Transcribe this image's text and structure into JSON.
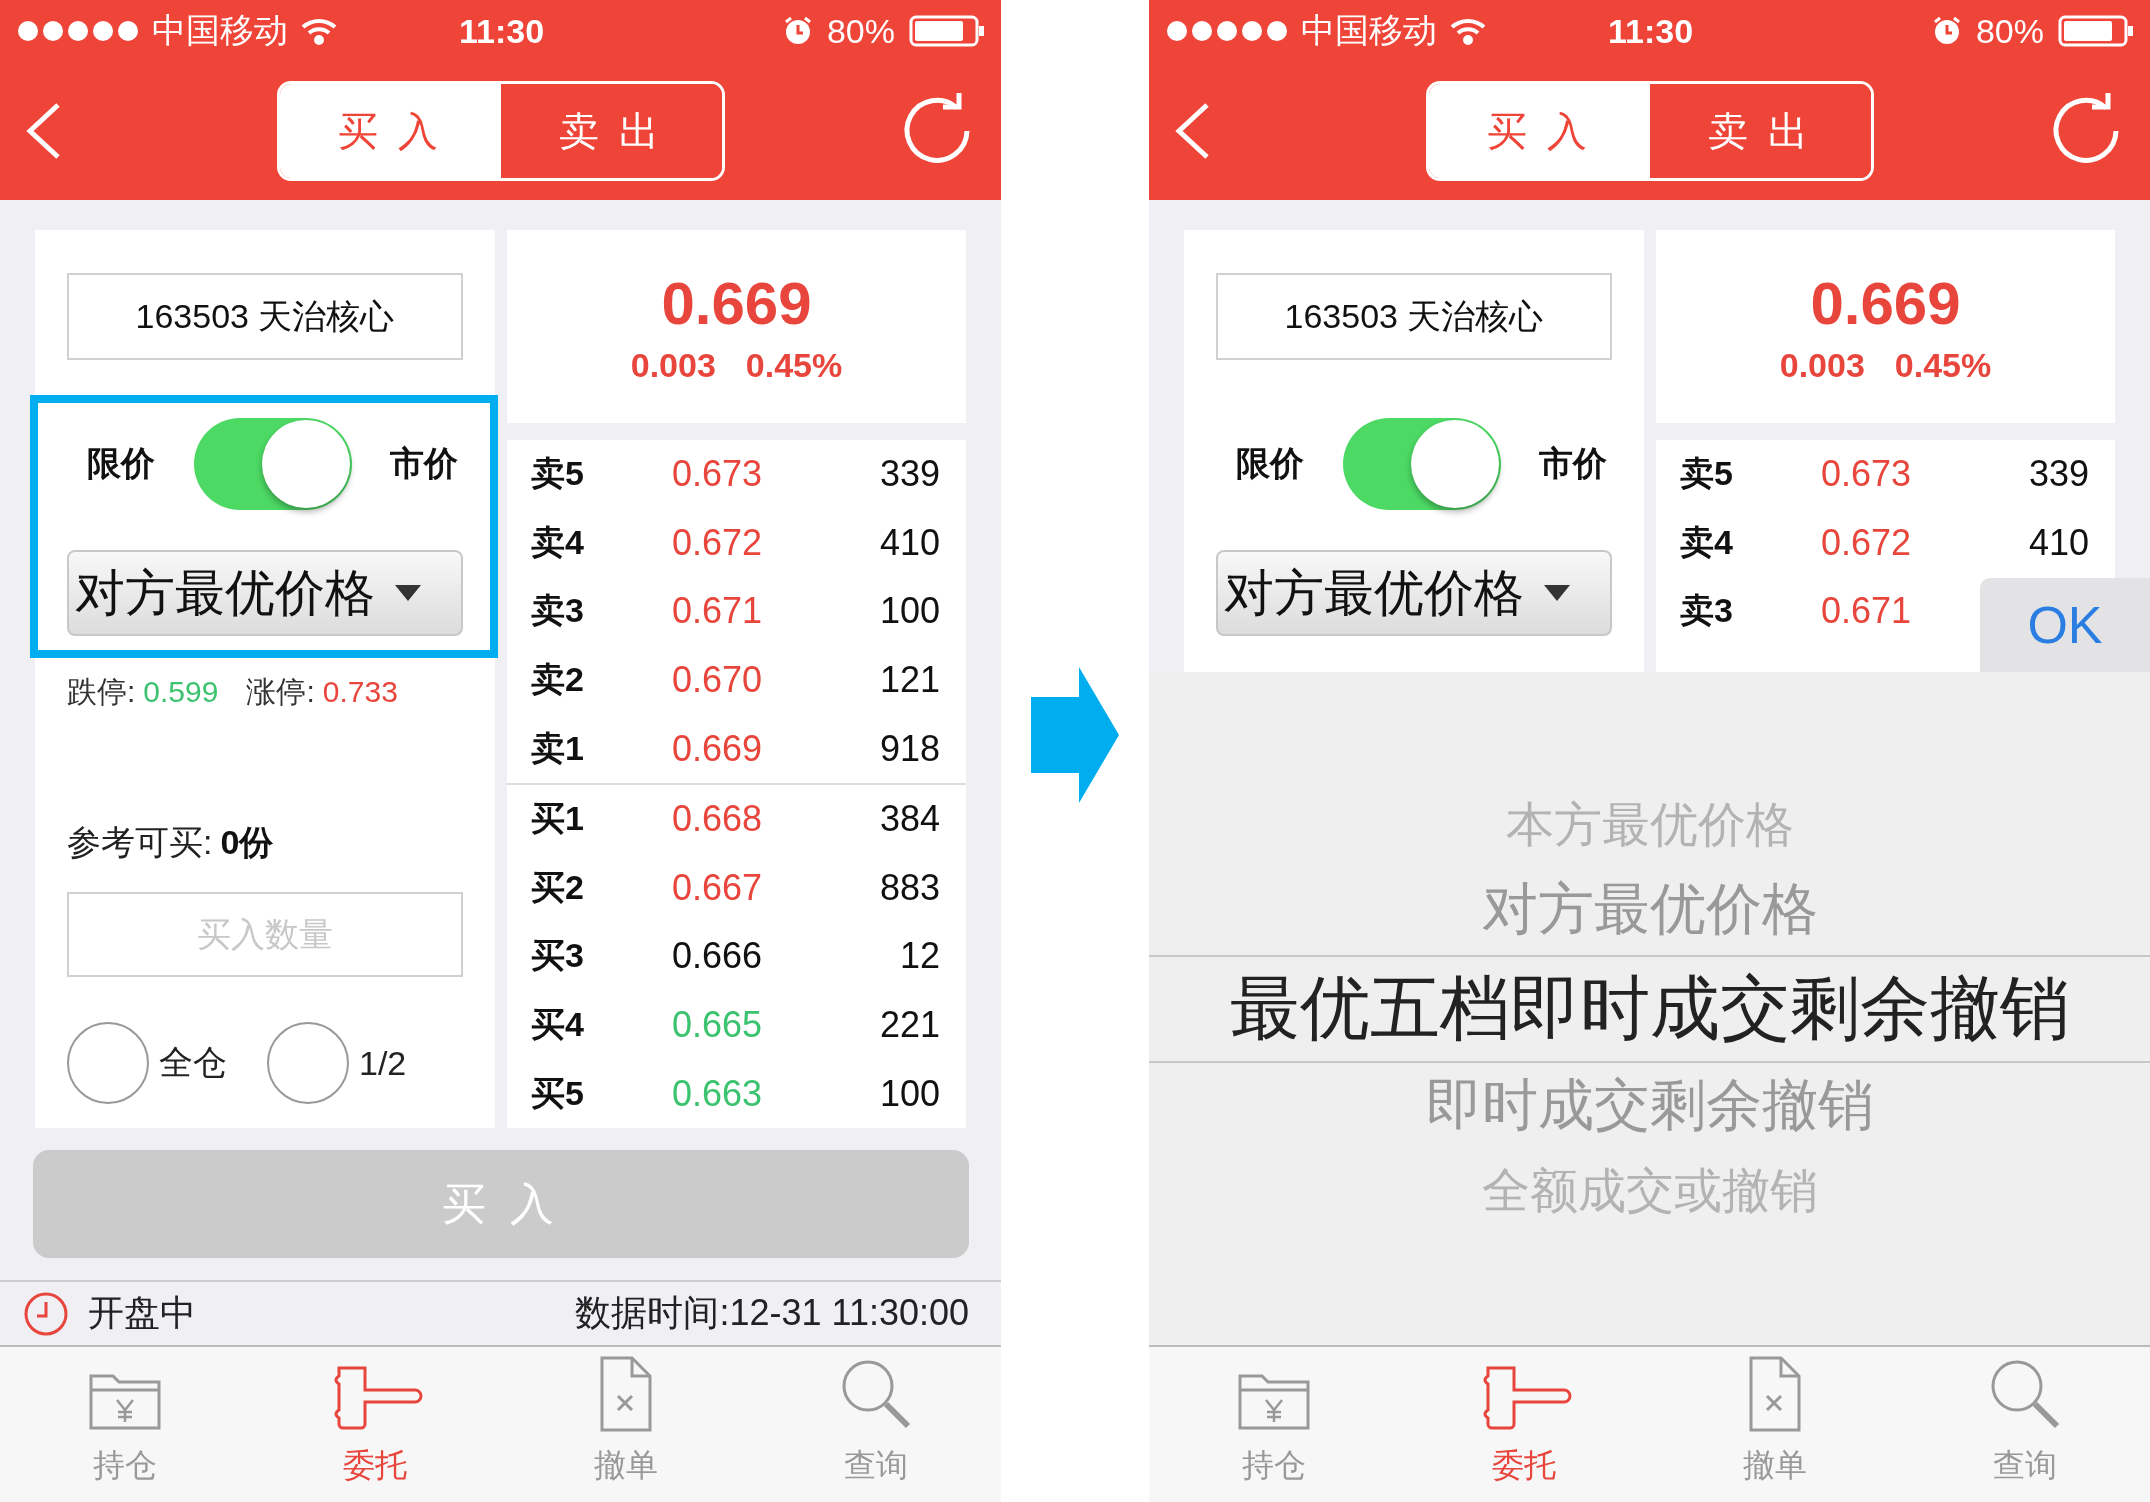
{
  "screens": [
    {
      "status_bar": {
        "carrier": "中国移动",
        "time": "11:30",
        "battery": "80%"
      },
      "nav": {
        "tabs": [
          {
            "label": "买 入",
            "selected": true
          },
          {
            "label": "卖 出",
            "selected": false
          }
        ]
      },
      "security": "163503 天治核心",
      "quote": {
        "price": "0.669",
        "change": "0.003",
        "change_pct": "0.45%"
      },
      "price_type": {
        "left_label": "限价",
        "right_label": "市价",
        "on": true,
        "highlighted": true
      },
      "order_type": "对方最优价格",
      "limits": {
        "down_label": "跌停:",
        "down": "0.599",
        "up_label": "涨停:",
        "up": "0.733"
      },
      "available": {
        "label": "参考可买:",
        "value": "0份"
      },
      "quantity": {
        "placeholder": "买入数量"
      },
      "fractions": [
        {
          "label": "全仓",
          "selected": false
        },
        {
          "label": "1/2",
          "selected": false
        }
      ],
      "order_book": {
        "asks": [
          {
            "label": "卖5",
            "price": "0.673",
            "qty": "339",
            "color": "#e8453c"
          },
          {
            "label": "卖4",
            "price": "0.672",
            "qty": "410",
            "color": "#e8453c"
          },
          {
            "label": "卖3",
            "price": "0.671",
            "qty": "100",
            "color": "#e8453c"
          },
          {
            "label": "卖2",
            "price": "0.670",
            "qty": "121",
            "color": "#e8453c"
          },
          {
            "label": "卖1",
            "price": "0.669",
            "qty": "918",
            "color": "#e8453c"
          }
        ],
        "bids": [
          {
            "label": "买1",
            "price": "0.668",
            "qty": "384",
            "color": "#e8453c"
          },
          {
            "label": "买2",
            "price": "0.667",
            "qty": "883",
            "color": "#e8453c"
          },
          {
            "label": "买3",
            "price": "0.666",
            "qty": "12",
            "color": "#111111"
          },
          {
            "label": "买4",
            "price": "0.665",
            "qty": "221",
            "color": "#3cc36f"
          },
          {
            "label": "买5",
            "price": "0.663",
            "qty": "100",
            "color": "#3cc36f"
          }
        ]
      },
      "submit": "买 入",
      "status": {
        "state": "开盘中",
        "data_time": "数据时间:12-31 11:30:00"
      },
      "tab_bar": [
        {
          "label": "持仓",
          "kind": "folder",
          "selected": false
        },
        {
          "label": "委托",
          "kind": "gavel",
          "selected": true
        },
        {
          "label": "撤单",
          "kind": "cancel",
          "selected": false
        },
        {
          "label": "查询",
          "kind": "search",
          "selected": false
        }
      ]
    },
    {
      "status_bar": {
        "carrier": "中国移动",
        "time": "11:30",
        "battery": "80%"
      },
      "nav": {
        "tabs": [
          {
            "label": "买 入",
            "selected": true
          },
          {
            "label": "卖 出",
            "selected": false
          }
        ]
      },
      "security": "163503 天治核心",
      "quote": {
        "price": "0.669",
        "change": "0.003",
        "change_pct": "0.45%"
      },
      "price_type": {
        "left_label": "限价",
        "right_label": "市价",
        "on": true
      },
      "order_type": "对方最优价格",
      "order_book": {
        "asks": [
          {
            "label": "卖5",
            "price": "0.673",
            "qty": "339",
            "color": "#e8453c"
          },
          {
            "label": "卖4",
            "price": "0.672",
            "qty": "410",
            "color": "#e8453c"
          },
          {
            "label": "卖3",
            "price": "0.671",
            "color": "#e8453c"
          }
        ]
      },
      "picker": {
        "done": "OK",
        "options": [
          {
            "label": "本方最优价格",
            "selected": false
          },
          {
            "label": "对方最优价格",
            "selected": false
          },
          {
            "label": "最优五档即时成交剩余撤销",
            "selected": true
          },
          {
            "label": "即时成交剩余撤销",
            "selected": false
          },
          {
            "label": "全额成交或撤销",
            "selected": false
          }
        ]
      },
      "tab_bar": [
        {
          "label": "持仓",
          "kind": "folder",
          "selected": false
        },
        {
          "label": "委托",
          "kind": "gavel",
          "selected": true
        },
        {
          "label": "撤单",
          "kind": "cancel",
          "selected": false
        },
        {
          "label": "查询",
          "kind": "search",
          "selected": false
        }
      ]
    }
  ]
}
